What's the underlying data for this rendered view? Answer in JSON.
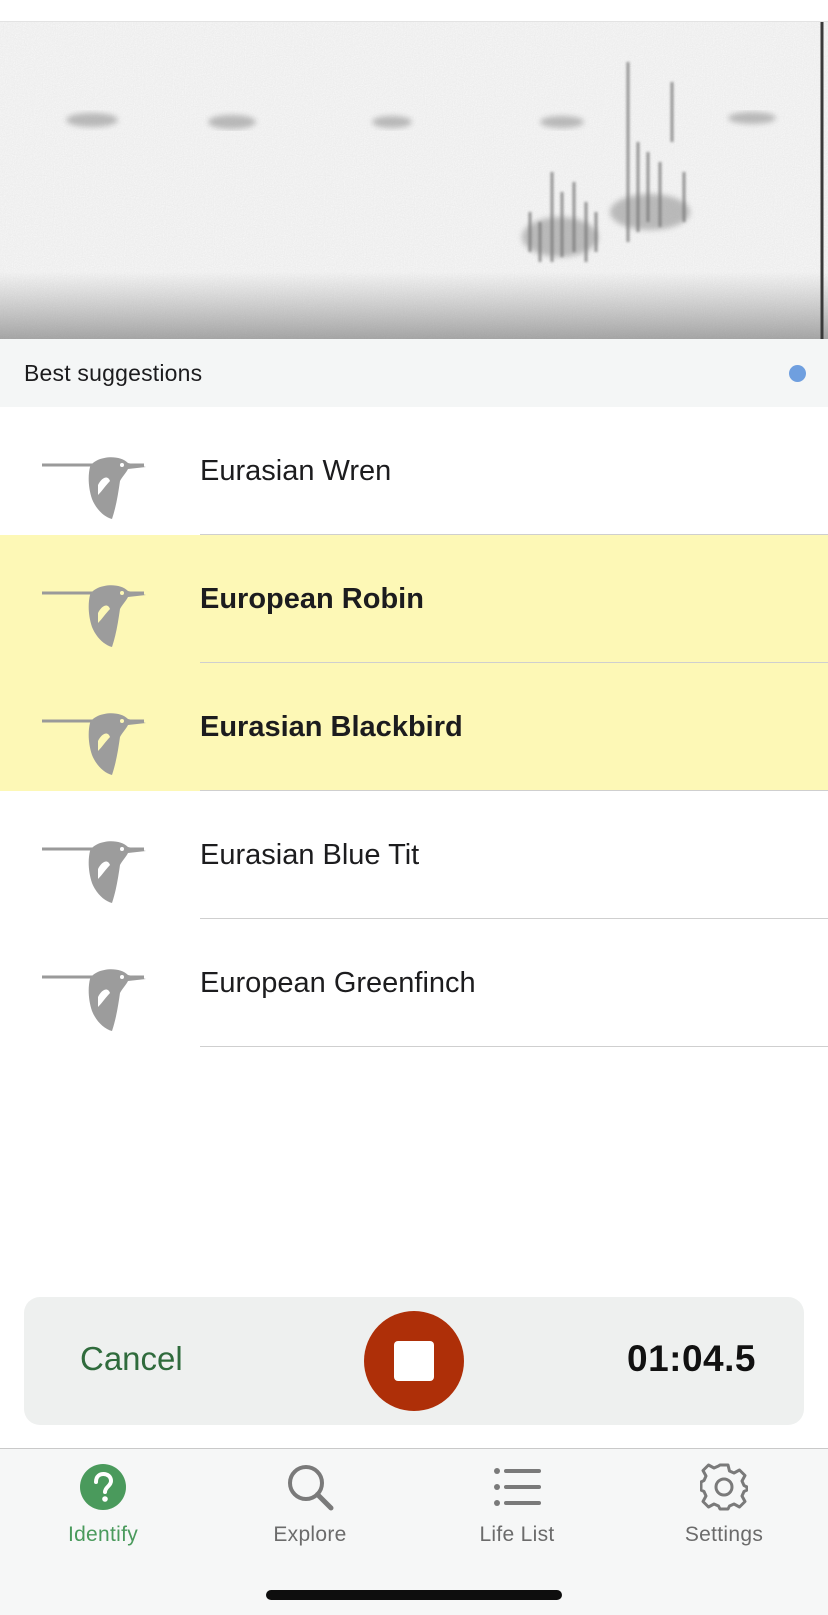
{
  "suggestions": {
    "title": "Best suggestions",
    "indicator_color": "#6f9fdf",
    "birds": [
      {
        "name": "Eurasian Wren",
        "highlighted": false,
        "icon": "bird-silhouette-icon"
      },
      {
        "name": "European Robin",
        "highlighted": true,
        "icon": "bird-silhouette-icon"
      },
      {
        "name": "Eurasian Blackbird",
        "highlighted": true,
        "icon": "bird-silhouette-icon"
      },
      {
        "name": "Eurasian Blue Tit",
        "highlighted": false,
        "icon": "bird-silhouette-icon"
      },
      {
        "name": "European Greenfinch",
        "highlighted": false,
        "icon": "bird-silhouette-icon"
      }
    ]
  },
  "recorder": {
    "cancel_label": "Cancel",
    "stop_icon": "stop-icon",
    "elapsed": "01:04.5",
    "stop_color": "#ae2f08"
  },
  "tabbar": {
    "tabs": [
      {
        "label": "Identify",
        "icon": "question-icon",
        "active": true
      },
      {
        "label": "Explore",
        "icon": "search-icon",
        "active": false
      },
      {
        "label": "Life List",
        "icon": "list-icon",
        "active": false
      },
      {
        "label": "Settings",
        "icon": "gear-icon",
        "active": false
      }
    ],
    "active_color": "#4a9a5c"
  }
}
